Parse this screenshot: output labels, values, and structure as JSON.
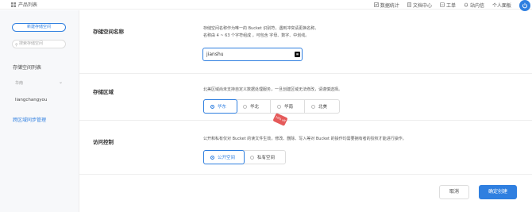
{
  "header": {
    "title": "产品列表",
    "nav": [
      {
        "label": "数据统计",
        "icon": "chart-icon"
      },
      {
        "label": "文档中心",
        "icon": "document-icon"
      },
      {
        "label": "工单",
        "icon": "ticket-icon"
      },
      {
        "label": "站内信",
        "icon": "bell-icon"
      },
      {
        "label": "个人面板",
        "icon": "user-icon"
      }
    ],
    "accent": "#2f7fe0"
  },
  "sidebar": {
    "new_bucket_label": "新建存储空间",
    "search_placeholder": "搜索存储空间",
    "list_title": "存储空间列表",
    "group_label": "华南",
    "bucket_name": "liangchangyou",
    "cross_region_link": "跨区域同步管理"
  },
  "form": {
    "name": {
      "label": "存储空间名称",
      "desc_line1": "存储空间名称作为唯一的 Bucket 识别符，遇到冲突请更换名称。",
      "desc_line2": "名称由 4 ~ 63 个字符组成 ，可包含 字母、数字、中划线。",
      "value": "jianshu"
    },
    "region": {
      "label": "存储区域",
      "desc": "北美区域尚未支持自定义数据处理服务，一旦创建区域无法修改，请谨慎选择。",
      "options": [
        "华东",
        "华北",
        "华南",
        "北美"
      ],
      "selected": "华东",
      "badge": "10% off"
    },
    "access": {
      "label": "访问控制",
      "desc": "公开和私有仅对 Bucket 的读文件生效，修改、删除、写入等对 Bucket 的操作均需要拥有者的授权才能进行操作。",
      "options": [
        "公开空间",
        "私有空间"
      ],
      "selected": "公开空间"
    }
  },
  "actions": {
    "cancel": "取消",
    "create": "确定创建"
  }
}
